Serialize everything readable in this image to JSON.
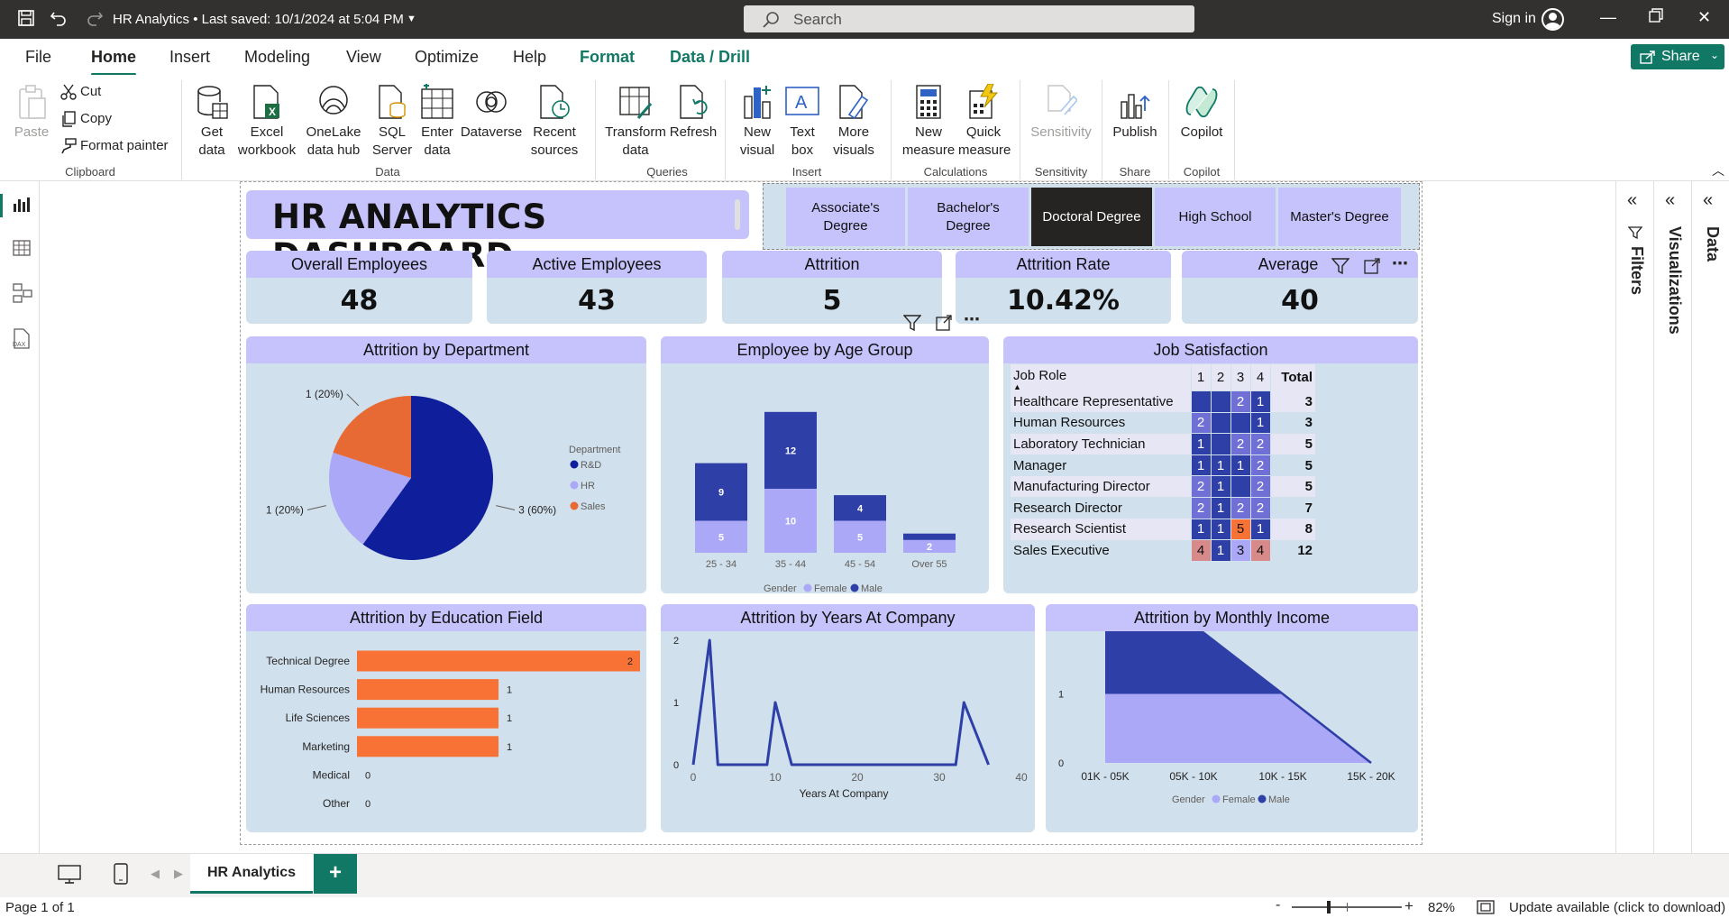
{
  "window": {
    "title": "HR Analytics  •  Last saved: 10/1/2024 at 5:04 PM",
    "search_placeholder": "Search",
    "signin": "Sign in"
  },
  "menu": {
    "items": [
      "File",
      "Home",
      "Insert",
      "Modeling",
      "View",
      "Optimize",
      "Help",
      "Format",
      "Data / Drill"
    ],
    "active": "Home",
    "share": "Share"
  },
  "ribbon": {
    "clipboard": {
      "paste": "Paste",
      "cut": "Cut",
      "copy": "Copy",
      "format_painter": "Format painter",
      "group": "Clipboard"
    },
    "data": {
      "get_data": "Get data",
      "excel": "Excel workbook",
      "onelake": "OneLake data hub",
      "sql": "SQL Server",
      "enter": "Enter data",
      "dataverse": "Dataverse",
      "recent": "Recent sources",
      "group": "Data"
    },
    "queries": {
      "transform": "Transform data",
      "refresh": "Refresh",
      "group": "Queries"
    },
    "insert": {
      "new_visual": "New visual",
      "text_box": "Text box",
      "more_visuals": "More visuals",
      "group": "Insert"
    },
    "calculations": {
      "new_measure": "New measure",
      "quick_measure": "Quick measure",
      "group": "Calculations"
    },
    "sensitivity": {
      "label": "Sensitivity",
      "group": "Sensitivity"
    },
    "share": {
      "publish": "Publish",
      "group": "Share"
    },
    "copilot": {
      "label": "Copilot",
      "group": "Copilot"
    }
  },
  "panes": {
    "filters": "Filters",
    "visualizations": "Visualizations",
    "data": "Data"
  },
  "dashboard": {
    "title": "HR ANALYTICS DASHBOARD",
    "slicer": {
      "options": [
        "Associate's Degree",
        "Bachelor's Degree",
        "Doctoral Degree",
        "High School",
        "Master's Degree"
      ],
      "selected": "Doctoral Degree"
    },
    "kpis": [
      {
        "label": "Overall Employees",
        "value": "48"
      },
      {
        "label": "Active Employees",
        "value": "43"
      },
      {
        "label": "Attrition",
        "value": "5"
      },
      {
        "label": "Attrition Rate",
        "value": "10.42%"
      },
      {
        "label": "Average Ag",
        "value": "40"
      }
    ]
  },
  "chart_data": [
    {
      "type": "pie",
      "title": "Attrition by Department",
      "legend_title": "Department",
      "legend_position": "right",
      "slices": [
        {
          "name": "R&D",
          "value": 3,
          "label": "3 (60%)",
          "color": "#0f1f9c"
        },
        {
          "name": "HR",
          "value": 1,
          "label": "1 (20%)",
          "color": "#aaa8f7"
        },
        {
          "name": "Sales",
          "value": 1,
          "label": "1 (20%)",
          "color": "#e76a35"
        }
      ]
    },
    {
      "type": "bar",
      "stacked": true,
      "title": "Employee by Age Group",
      "legend_title": "Gender",
      "legend_position": "bottom",
      "categories": [
        "25 - 34",
        "35 - 44",
        "45 - 54",
        "Over 55"
      ],
      "series": [
        {
          "name": "Female",
          "values": [
            5,
            10,
            5,
            2
          ],
          "color": "#aaa8f7"
        },
        {
          "name": "Male",
          "values": [
            9,
            12,
            4,
            1
          ],
          "color": "#2e3fa8"
        }
      ],
      "value_labels": [
        [
          "5",
          "10",
          "5",
          "2"
        ],
        [
          "9",
          "12",
          "4",
          ""
        ]
      ]
    },
    {
      "type": "table",
      "title": "Job Satisfaction",
      "row_header": "Job Role",
      "columns": [
        "1",
        "2",
        "3",
        "4"
      ],
      "total_label": "Total",
      "rows": [
        {
          "role": "Healthcare Representative",
          "values": [
            "",
            "",
            "2",
            "1"
          ],
          "total": "3"
        },
        {
          "role": "Human Resources",
          "values": [
            "2",
            "",
            "",
            "1"
          ],
          "total": "3"
        },
        {
          "role": "Laboratory Technician",
          "values": [
            "1",
            "",
            "2",
            "2"
          ],
          "total": "5"
        },
        {
          "role": "Manager",
          "values": [
            "1",
            "1",
            "1",
            "2"
          ],
          "total": "5"
        },
        {
          "role": "Manufacturing Director",
          "values": [
            "2",
            "1",
            "",
            "2"
          ],
          "total": "5"
        },
        {
          "role": "Research Director",
          "values": [
            "2",
            "1",
            "2",
            "2"
          ],
          "total": "7"
        },
        {
          "role": "Research Scientist",
          "values": [
            "1",
            "1",
            "5",
            "1"
          ],
          "total": "8"
        },
        {
          "role": "Sales Executive",
          "values": [
            "4",
            "1",
            "3",
            "4"
          ],
          "total": "12"
        }
      ]
    },
    {
      "type": "bar",
      "orientation": "horizontal",
      "title": "Attrition by Education Field",
      "categories": [
        "Technical Degree",
        "Human Resources",
        "Life Sciences",
        "Marketing",
        "Medical",
        "Other"
      ],
      "values": [
        2,
        1,
        1,
        1,
        0,
        0
      ],
      "value_labels": [
        "2",
        "1",
        "1",
        "1",
        "0",
        "0"
      ],
      "color": "#f87235"
    },
    {
      "type": "line",
      "title": "Attrition by Years At Company",
      "xlabel": "Years At Company",
      "x": [
        0,
        2,
        3,
        9,
        10,
        12,
        32,
        33,
        36
      ],
      "y": [
        0,
        2,
        0,
        0,
        1,
        0,
        0,
        1,
        0
      ],
      "xlim": [
        0,
        40
      ],
      "ylim": [
        0,
        2
      ],
      "xticks": [
        "0",
        "10",
        "20",
        "30",
        "40"
      ],
      "yticks": [
        "0",
        "1",
        "2"
      ],
      "color": "#2e3fa8"
    },
    {
      "type": "area",
      "stacked": true,
      "title": "Attrition by Monthly Income",
      "legend_title": "Gender",
      "legend_position": "bottom",
      "categories": [
        "01K - 05K",
        "05K - 10K",
        "10K - 15K",
        "15K - 20K"
      ],
      "ylim": [
        0,
        2
      ],
      "yticks": [
        "0",
        "1",
        "2"
      ],
      "series": [
        {
          "name": "Female",
          "values": [
            1,
            1,
            1,
            0
          ],
          "color": "#aaa8f7"
        },
        {
          "name": "Male",
          "values": [
            1,
            1,
            0,
            0
          ],
          "color": "#2e3fa8"
        }
      ]
    }
  ],
  "pages": {
    "tab": "HR Analytics"
  },
  "status": {
    "page": "Page 1 of 1",
    "zoom": "82%",
    "update": "Update available (click to download)"
  }
}
